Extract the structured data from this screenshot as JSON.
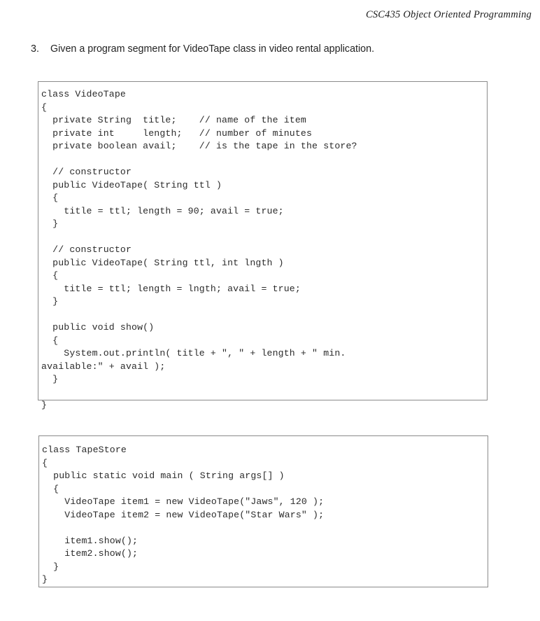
{
  "header": {
    "course_title": "CSC435 Object Oriented Programming"
  },
  "question": {
    "number": "3.",
    "text": "Given a program segment for VideoTape class in video rental application."
  },
  "code_blocks": [
    {
      "name": "videotape-class",
      "language": "java",
      "code": "class VideoTape\n{\n  private String  title;    // name of the item\n  private int     length;   // number of minutes\n  private boolean avail;    // is the tape in the store?\n\n  // constructor\n  public VideoTape( String ttl )\n  {\n    title = ttl; length = 90; avail = true;\n  }\n\n  // constructor\n  public VideoTape( String ttl, int lngth )\n  {\n    title = ttl; length = lngth; avail = true;\n  }\n\n  public void show()\n  {\n    System.out.println( title + \", \" + length + \" min.\navailable:\" + avail );\n  }\n\n}"
    },
    {
      "name": "tapestore-class",
      "language": "java",
      "code": "class TapeStore\n{\n  public static void main ( String args[] )\n  {\n    VideoTape item1 = new VideoTape(\"Jaws\", 120 );\n    VideoTape item2 = new VideoTape(\"Star Wars\" );\n\n    item1.show();\n    item2.show();\n  }\n}"
    }
  ]
}
